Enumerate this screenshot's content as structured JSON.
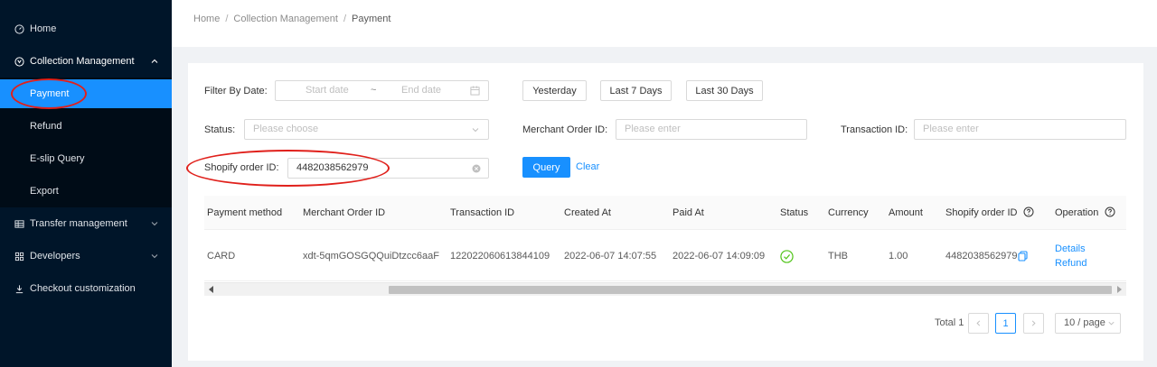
{
  "sidebar": {
    "items": [
      {
        "label": "Home",
        "icon": "dashboard-icon"
      },
      {
        "label": "Collection Management",
        "icon": "collection-icon"
      },
      {
        "label": "Payment"
      },
      {
        "label": "Refund"
      },
      {
        "label": "E-slip Query"
      },
      {
        "label": "Export"
      },
      {
        "label": "Transfer management",
        "icon": "table-icon"
      },
      {
        "label": "Developers",
        "icon": "grid-icon"
      },
      {
        "label": "Checkout customization",
        "icon": "customize-icon"
      }
    ]
  },
  "breadcrumb": {
    "home": "Home",
    "section": "Collection Management",
    "page": "Payment",
    "sep": "/"
  },
  "filters": {
    "date_label": "Filter By Date:",
    "start_placeholder": "Start date",
    "range_sep": "~",
    "end_placeholder": "End date",
    "yesterday": "Yesterday",
    "last7": "Last 7 Days",
    "last30": "Last 30 Days",
    "status_label": "Status:",
    "status_placeholder": "Please choose",
    "merchant_label": "Merchant Order ID:",
    "merchant_placeholder": "Please enter",
    "transaction_label": "Transaction ID:",
    "transaction_placeholder": "Please enter",
    "shopify_label": "Shopify order ID:",
    "shopify_value": "4482038562979",
    "query": "Query",
    "clear": "Clear"
  },
  "table": {
    "columns": [
      "Payment method",
      "Merchant Order ID",
      "Transaction ID",
      "Created At",
      "Paid At",
      "Status",
      "Currency",
      "Amount",
      "Shopify order ID",
      "Operation"
    ],
    "rows": [
      {
        "payment_method": "CARD",
        "merchant_order_id": "xdt-5qmGOSGQQuiDtzcc6aaF",
        "transaction_id": "122022060613844109",
        "created_at": "2022-06-07 14:07:55",
        "paid_at": "2022-06-07 14:09:09",
        "status_icon": "check-circle-icon",
        "currency": "THB",
        "amount": "1.00",
        "shopify_order_id": "4482038562979",
        "details": "Details",
        "refund": "Refund"
      }
    ]
  },
  "pagination": {
    "total": "Total 1",
    "current": "1",
    "page_size": "10 / page"
  },
  "colors": {
    "sidebar_bg": "#001529",
    "primary": "#1890ff",
    "success": "#52c41a",
    "annotation": "#e0201b"
  }
}
